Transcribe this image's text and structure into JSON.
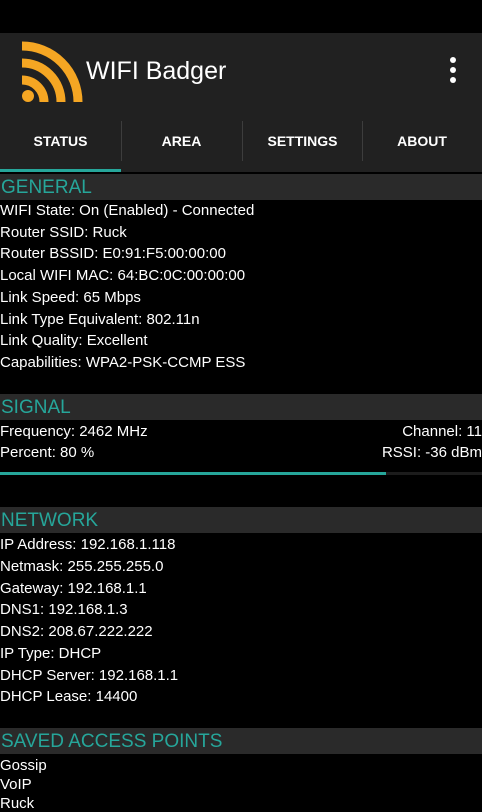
{
  "app": {
    "title": "WIFI Badger",
    "accent": "#26a69a",
    "logo_color": "#f5a623",
    "logo_icon": "rss-feed-icon",
    "menu_icon": "more-vert-icon"
  },
  "tabs": [
    {
      "label": "STATUS",
      "selected": true
    },
    {
      "label": "AREA",
      "selected": false
    },
    {
      "label": "SETTINGS",
      "selected": false
    },
    {
      "label": "ABOUT",
      "selected": false
    }
  ],
  "general": {
    "header": "GENERAL",
    "rows": [
      "WIFI State: On (Enabled) - Connected",
      "Router SSID: Ruck",
      "Router BSSID: E0:91:F5:00:00:00",
      "Local WIFI MAC: 64:BC:0C:00:00:00",
      "Link Speed: 65 Mbps",
      "Link Type Equivalent: 802.11n",
      "Link Quality: Excellent",
      "Capabilities: WPA2-PSK-CCMP ESS"
    ]
  },
  "signal": {
    "header": "SIGNAL",
    "frequency": "Frequency: 2462 MHz",
    "channel": "Channel: 11",
    "percent": "Percent: 80 %",
    "rssi": "RSSI: -36 dBm",
    "percent_value": 0.8
  },
  "network": {
    "header": "NETWORK",
    "rows": [
      "IP Address: 192.168.1.118",
      "Netmask: 255.255.255.0",
      "Gateway: 192.168.1.1",
      "DNS1: 192.168.1.3",
      "DNS2: 208.67.222.222",
      "IP Type: DHCP",
      "DHCP Server: 192.168.1.1",
      "DHCP Lease:  14400"
    ]
  },
  "saved": {
    "header": "SAVED ACCESS POINTS",
    "items": [
      "Gossip",
      "VoIP",
      "Ruck"
    ]
  }
}
